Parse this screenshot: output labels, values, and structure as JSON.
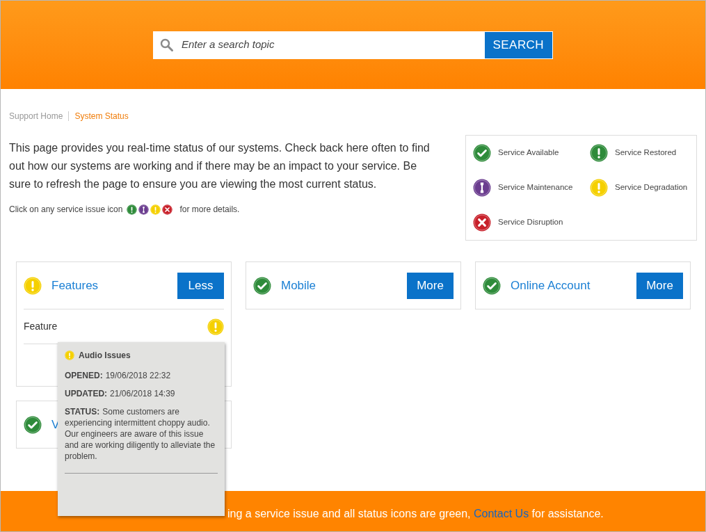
{
  "search": {
    "placeholder": "Enter a search topic",
    "button": "SEARCH"
  },
  "breadcrumb": [
    {
      "label": "Support Home",
      "selected": false
    },
    {
      "label": "System Status",
      "selected": true
    }
  ],
  "intro": "This page provides you real-time status of our systems. Check back here often to find out how our systems are working and if there may be an impact to your service. Be sure to refresh the page to ensure you are viewing the most current status.",
  "hint": {
    "before": "Click on any service issue icon",
    "icons": [
      {
        "kind": "restored"
      },
      {
        "kind": "maintenance"
      },
      {
        "kind": "degradation"
      },
      {
        "kind": "disruption"
      }
    ],
    "after": "for more details."
  },
  "legend": [
    {
      "kind": "available",
      "label": "Service Available"
    },
    {
      "kind": "restored",
      "label": "Service Restored"
    },
    {
      "kind": "maintenance",
      "label": "Service Maintenance"
    },
    {
      "kind": "degradation",
      "label": "Service Degradation"
    },
    {
      "kind": "disruption",
      "label": "Service Disruption"
    }
  ],
  "cards": [
    {
      "kind": "degradation",
      "title": "Features",
      "button": "Less",
      "expanded": true,
      "items": [
        {
          "label": "Feature",
          "kind": "degradation"
        }
      ]
    },
    {
      "kind": "available",
      "title": "Mobile",
      "button": "More",
      "expanded": false
    },
    {
      "kind": "available",
      "title": "Online Account",
      "button": "More",
      "expanded": false
    },
    {
      "kind": "available",
      "title": "V",
      "expanded": false
    }
  ],
  "popup": {
    "kind": "degradation",
    "title": "Audio Issues",
    "fields": [
      {
        "label": "OPENED:",
        "value": "19/06/2018 22:32"
      },
      {
        "label": "UPDATED:",
        "value": "21/06/2018 14:39"
      },
      {
        "label": "STATUS:",
        "value": "Some customers are experiencing intermittent choppy audio. Our engineers are aware of this issue and are working diligently to alleviate the problem."
      }
    ]
  },
  "footer": {
    "before": "ing a service issue and all status icons are green,",
    "link": "Contact Us",
    "after": "for assistance."
  }
}
